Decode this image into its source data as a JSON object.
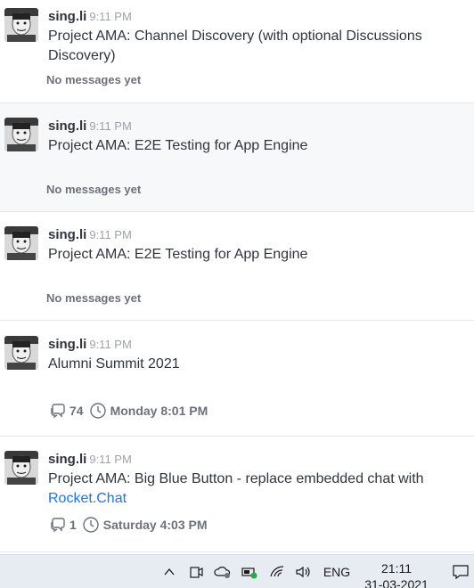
{
  "threads": [
    {
      "user": "sing.li",
      "time": "9:11 PM",
      "message": "Project AMA: Channel Discovery (with optional Discussions Discovery)",
      "footer": "No messages yet"
    },
    {
      "user": "sing.li",
      "time": "9:11 PM",
      "message": "Project AMA: E2E Testing for App Engine",
      "footer": "No messages yet"
    },
    {
      "user": "sing.li",
      "time": "9:11 PM",
      "message": "Project AMA: E2E Testing for App Engine",
      "footer": "No messages yet"
    },
    {
      "user": "sing.li",
      "time": "9:11 PM",
      "message": "Alumni Summit 2021",
      "reply_count": "74",
      "last_reply": "Monday 8:01 PM"
    },
    {
      "user": "sing.li",
      "time": "9:11 PM",
      "message_prefix": "Project AMA: Big Blue Button - replace embedded chat with",
      "message_link": "Rocket.Chat",
      "reply_count": "1",
      "last_reply": "Saturday 4:03 PM"
    }
  ],
  "taskbar": {
    "language": "ENG",
    "clock_time": "21:11",
    "clock_date": "31-03-2021",
    "icons": [
      "chevron-up-icon",
      "meet-now-icon",
      "onedrive-icon",
      "battery-icon",
      "wifi-icon",
      "volume-icon",
      "notifications-icon"
    ]
  },
  "colors": {
    "link": "#1d74f5",
    "muted": "#9ea2a8",
    "hover_row": "#f7f8fa",
    "taskbar": "#e6ecf2"
  }
}
